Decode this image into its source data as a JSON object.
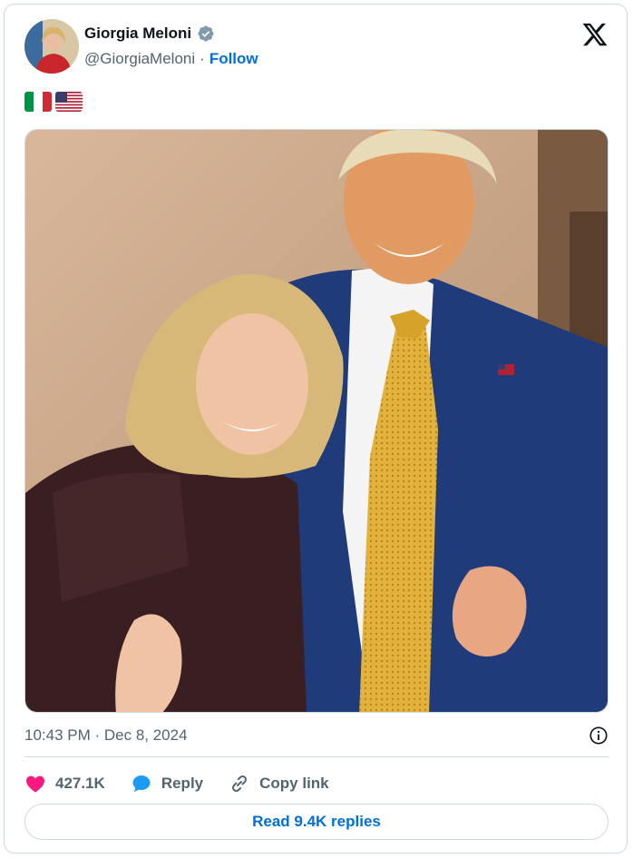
{
  "author": {
    "name": "Giorgia Meloni",
    "handle": "@GiorgiaMeloni",
    "separator": "·",
    "follow_label": "Follow"
  },
  "post": {
    "flags": [
      "italy-flag",
      "usa-flag"
    ],
    "timestamp": "10:43 PM · Dec 8, 2024"
  },
  "actions": {
    "likes": "427.1K",
    "reply_label": "Reply",
    "copy_link_label": "Copy link"
  },
  "read_replies_label": "Read 9.4K replies",
  "colors": {
    "accent": "#006fd6",
    "heart": "#f91880",
    "reply_bubble": "#1d9bf0",
    "verified": "#829aab",
    "secondary_text": "#536471"
  }
}
